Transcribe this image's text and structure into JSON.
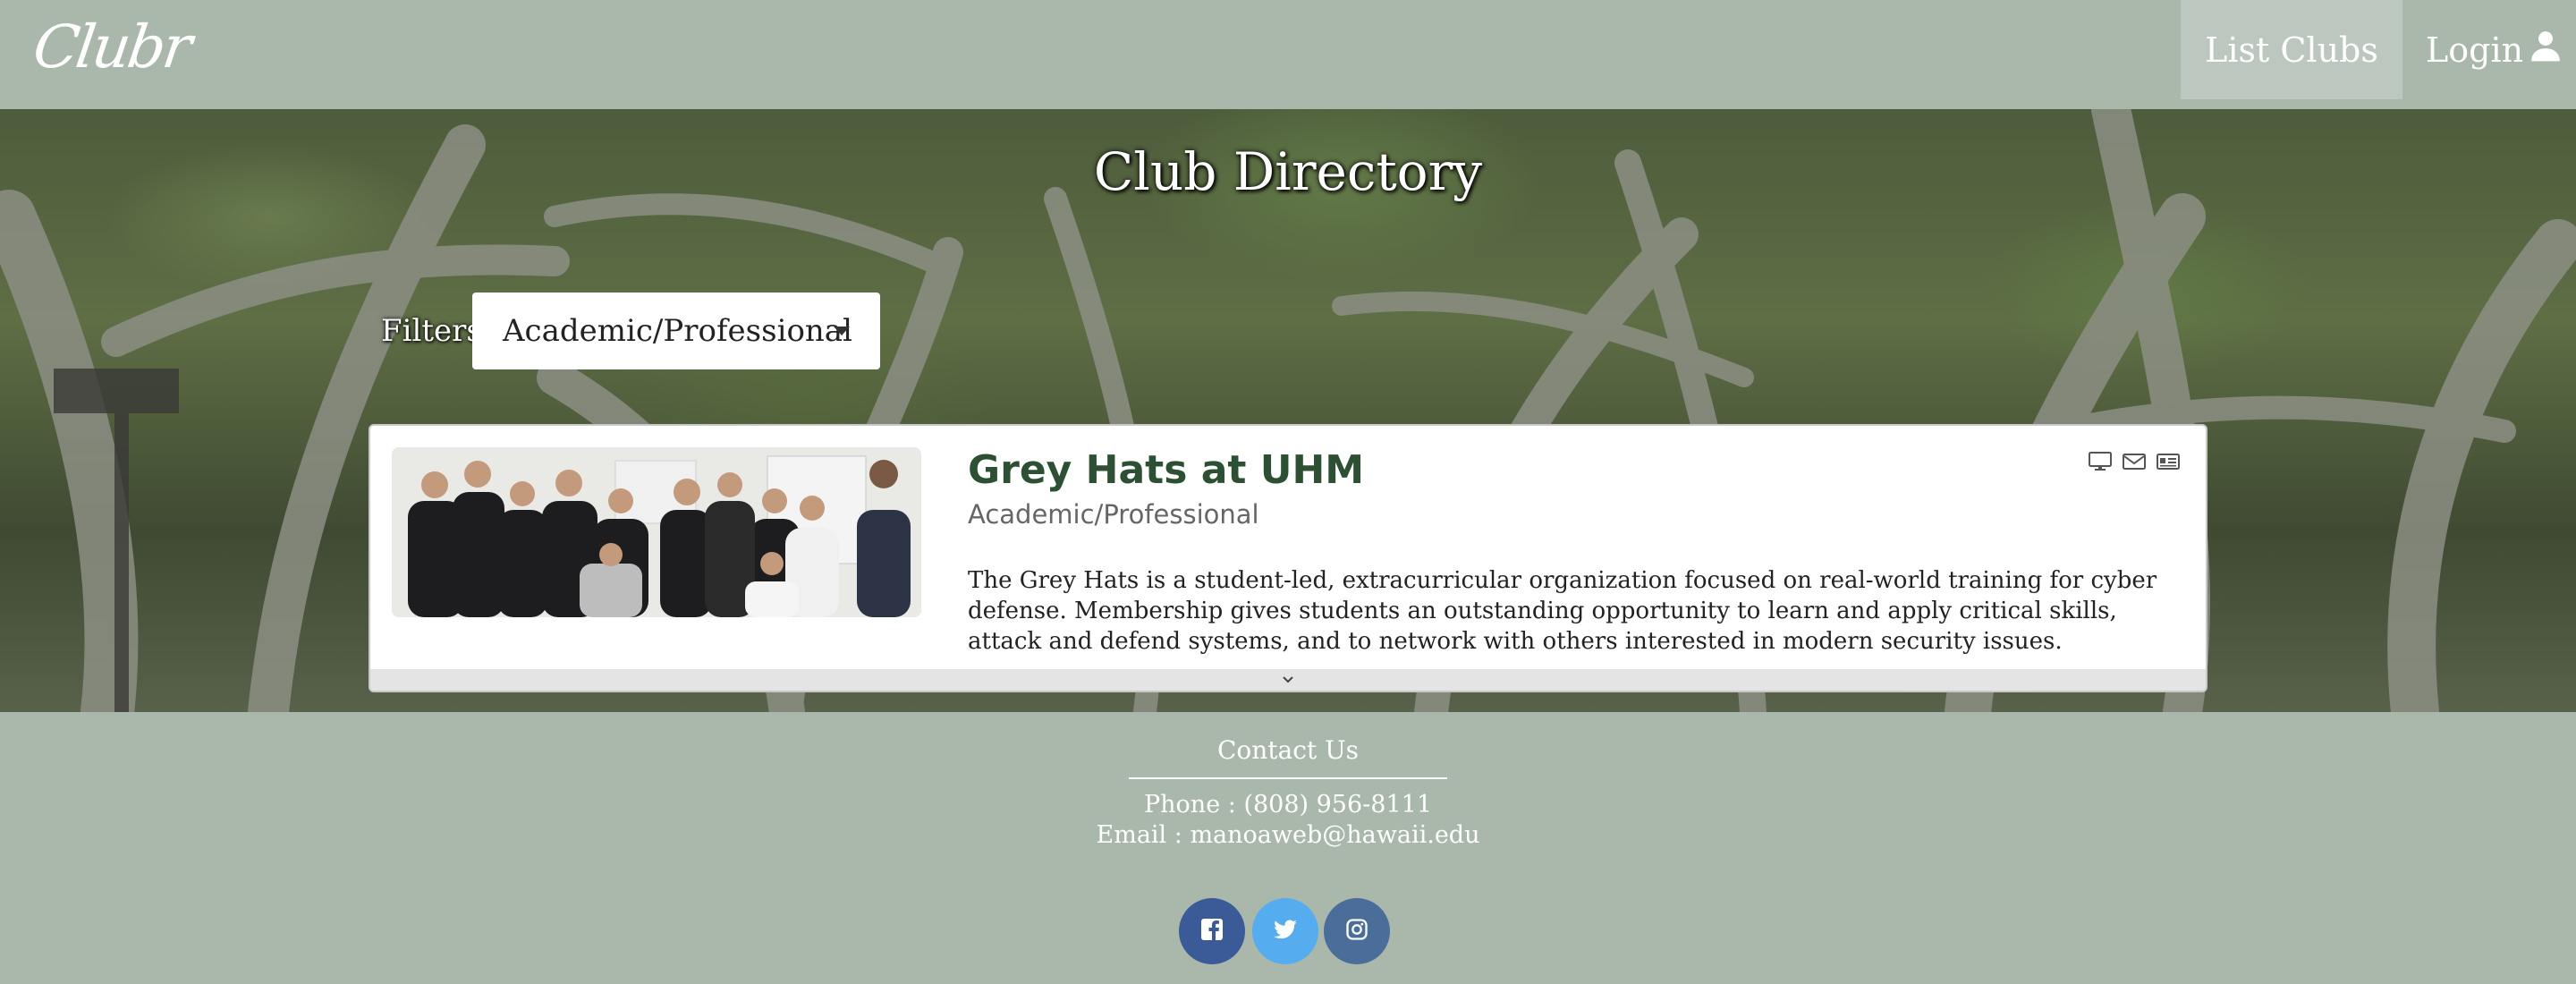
{
  "header": {
    "logo": "Clubr",
    "nav": {
      "list_clubs": "List Clubs",
      "login": "Login"
    }
  },
  "hero": {
    "title": "Club Directory",
    "filters_label": "Filters",
    "filter_value": "Academic/Professional"
  },
  "club": {
    "name": "Grey Hats at UHM",
    "category": "Academic/Professional",
    "description": "The Grey Hats is a student-led, extracurricular organization focused on real-world training for cyber defense. Membership gives students an outstanding opportunity to learn and apply critical skills, attack and defend systems, and to network with others interested in modern security issues.",
    "icons": [
      "monitor-icon",
      "envelope-icon",
      "id-card-icon"
    ]
  },
  "footer": {
    "contact_title": "Contact Us",
    "phone": "Phone : (808) 956-8111",
    "email": "Email : manoaweb@hawaii.edu",
    "social": [
      "facebook-icon",
      "twitter-icon",
      "instagram-icon"
    ]
  },
  "colors": {
    "header_bg": "#aab8ac",
    "title_green": "#2d4f33",
    "facebook": "#3b5a98",
    "twitter": "#55acee",
    "instagram": "#4a6d9a"
  }
}
